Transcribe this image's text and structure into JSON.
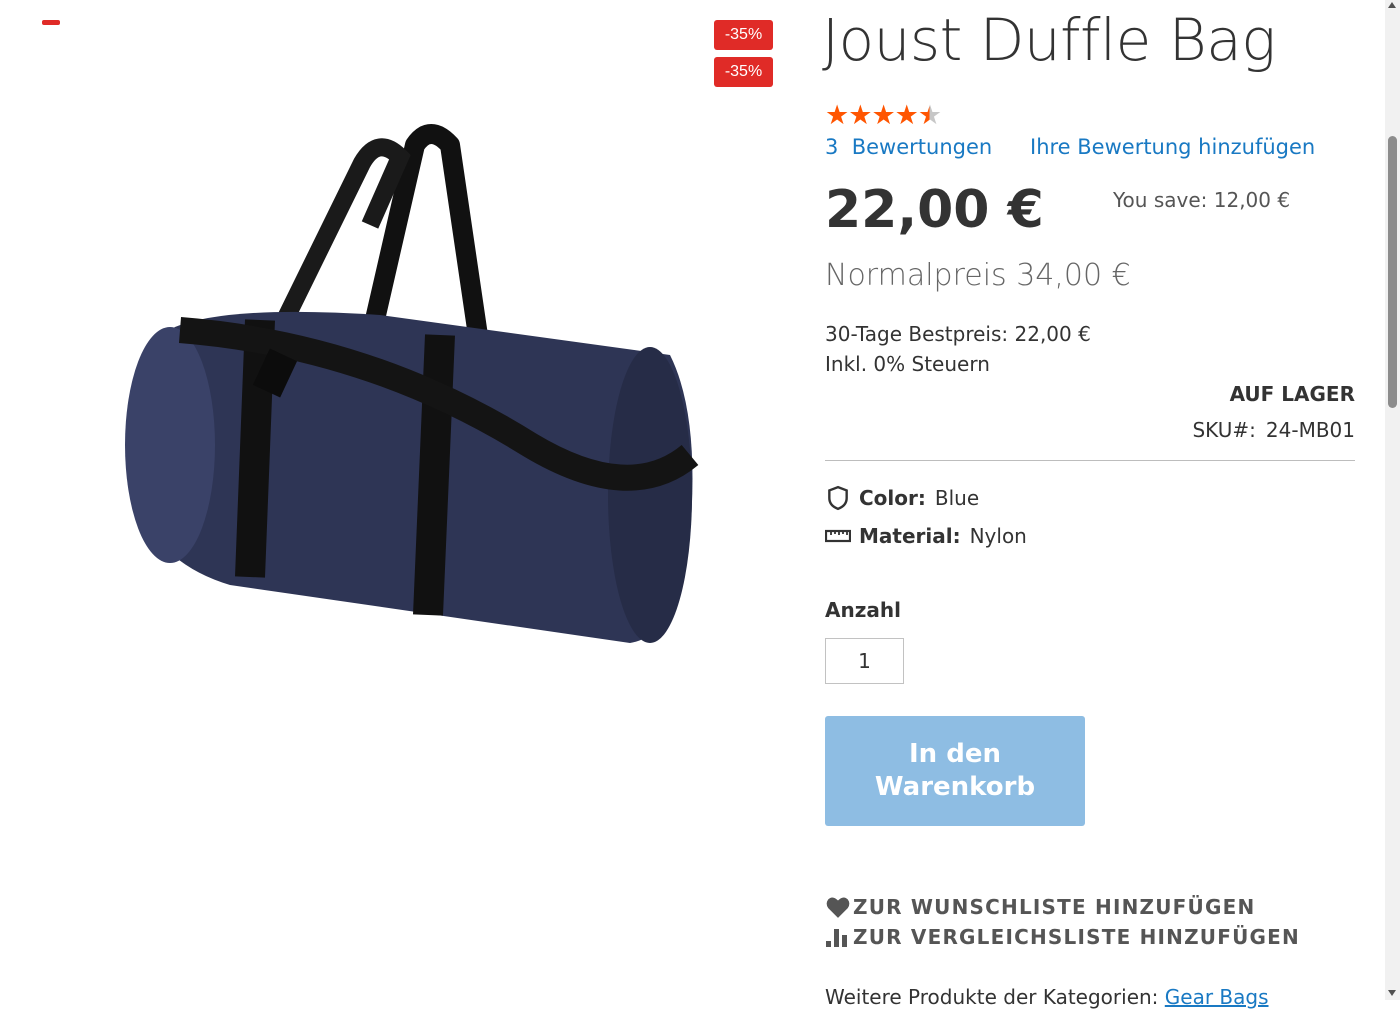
{
  "product": {
    "name": "Joust Duffle Bag",
    "rating_percent": 90,
    "reviews_count": "3",
    "reviews_label": "Bewertungen",
    "add_review_label": "Ihre Bewertung hinzufügen",
    "final_price": "22,00 €",
    "you_save": "You save: 12,00 €",
    "regular_price": "Normalpreis 34,00 €",
    "best_price_30d": "30-Tage Bestpreis: 22,00 €",
    "tax_note": "Inkl. 0% Steuern",
    "stock_status": "Auf Lager",
    "sku_label": "SKU#:",
    "sku_value": "24-MB01",
    "discount_badges": [
      "-35%",
      "-35%"
    ],
    "image_icon": "duffle-bag-image"
  },
  "attributes": {
    "color": {
      "label": "Color:",
      "value": "Blue",
      "icon": "shield-icon"
    },
    "material": {
      "label": "Material:",
      "value": "Nylon",
      "icon": "ruler-icon"
    }
  },
  "purchase": {
    "qty_label": "Anzahl",
    "qty_value": "1",
    "add_to_cart_label": "In den Warenkorb"
  },
  "actions": {
    "wishlist_label": "Zur Wunschliste hinzufügen",
    "compare_label": "Zur Vergleichsliste hinzufügen"
  },
  "more_products": {
    "prefix": "Weitere Produkte der Kategorien:",
    "category": "Gear Bags"
  },
  "colors": {
    "accent": "#1979c3",
    "badge": "#e02b27",
    "stars": "#ff5501",
    "cart_button": "#8ebde3"
  }
}
